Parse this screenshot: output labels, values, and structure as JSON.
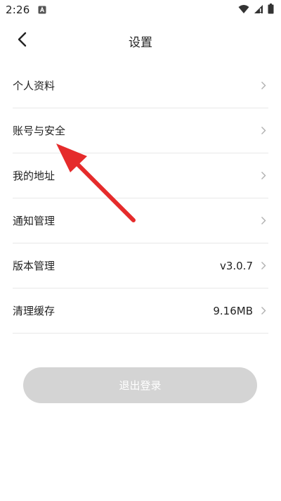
{
  "status_bar": {
    "time": "2:26",
    "icons": [
      "notification-a-icon",
      "wifi-icon",
      "signal-icon",
      "battery-icon"
    ]
  },
  "header": {
    "title": "设置",
    "back_icon": "chevron-left-icon"
  },
  "settings": {
    "items": [
      {
        "label": "个人资料",
        "value": ""
      },
      {
        "label": "账号与安全",
        "value": ""
      },
      {
        "label": "我的地址",
        "value": ""
      },
      {
        "label": "通知管理",
        "value": ""
      },
      {
        "label": "版本管理",
        "value": "v3.0.7"
      },
      {
        "label": "清理缓存",
        "value": "9.16MB"
      }
    ]
  },
  "logout": {
    "label": "退出登录"
  },
  "colors": {
    "annotation": "#e52b2b",
    "divider": "#e8e8e8",
    "logout_bg": "#d4d4d4",
    "chevron": "#b0b0b0"
  }
}
